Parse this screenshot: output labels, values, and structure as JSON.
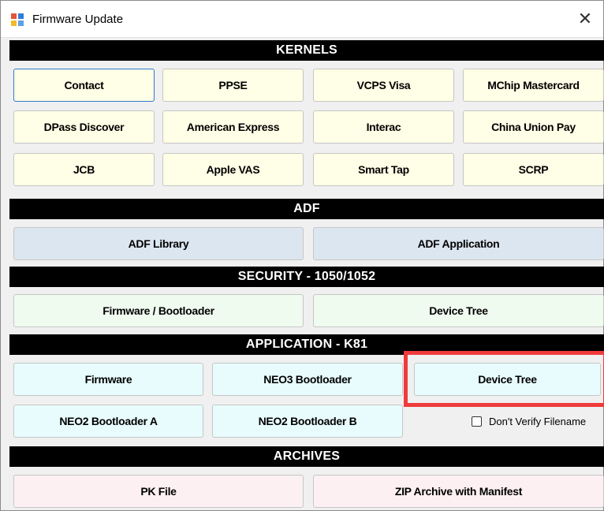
{
  "window": {
    "title": "Firmware Update",
    "close_glyph": "✕"
  },
  "kernels": {
    "header": "KERNELS",
    "buttons": [
      "Contact",
      "PPSE",
      "VCPS Visa",
      "MChip Mastercard",
      "DPass Discover",
      "American Express",
      "Interac",
      "China Union Pay",
      "JCB",
      "Apple VAS",
      "Smart Tap",
      "SCRP"
    ]
  },
  "adf": {
    "header": "ADF",
    "buttons": [
      "ADF Library",
      "ADF Application"
    ]
  },
  "security": {
    "header": "SECURITY - 1050/1052",
    "buttons": [
      "Firmware / Bootloader",
      "Device Tree"
    ]
  },
  "application": {
    "header": "APPLICATION - K81",
    "buttons": [
      "Firmware",
      "NEO3 Bootloader",
      "Device Tree",
      "NEO2 Bootloader A",
      "NEO2 Bootloader B"
    ],
    "verify_checkbox": {
      "label": "Don't Verify Filename",
      "checked": false
    }
  },
  "archives": {
    "header": "ARCHIVES",
    "buttons": [
      "PK File",
      "ZIP Archive with Manifest"
    ]
  },
  "colors": {
    "kernel_button": "#fffee6",
    "adf_button": "#dce6f0",
    "security_button": "#f0fbf0",
    "application_button": "#e8fcfd",
    "archive_button": "#fdf0f2",
    "highlight": "#ef3b3b",
    "section_bar": "#000000"
  },
  "icons": {
    "app": "firmware-window-icon",
    "close": "close-icon",
    "checkbox": "checkbox-icon"
  }
}
